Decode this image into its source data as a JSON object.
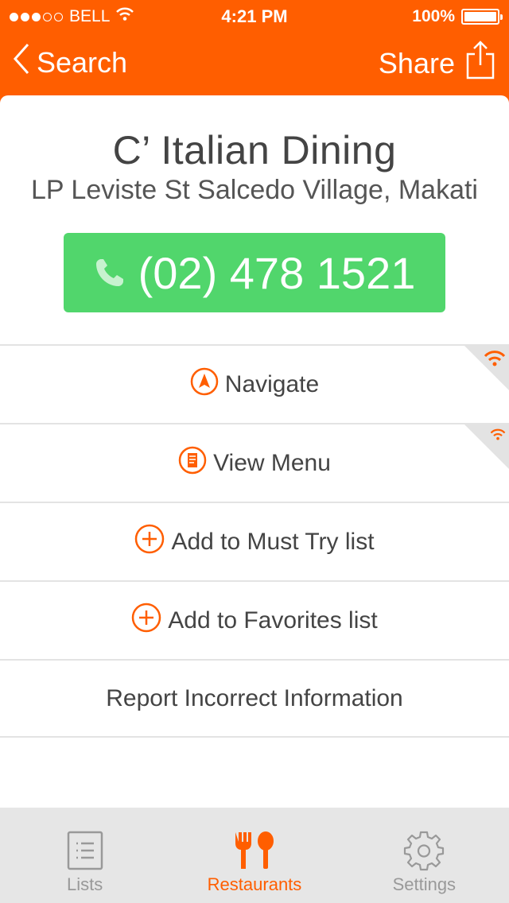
{
  "status_bar": {
    "carrier": "BELL",
    "time": "4:21 PM",
    "battery": "100%",
    "signal_bars_filled": 3,
    "signal_bars_total": 5
  },
  "nav": {
    "back_label": "Search",
    "share_label": "Share"
  },
  "restaurant": {
    "name": "C’ Italian Dining",
    "address": "LP Leviste St Salcedo Village, Makati",
    "phone": "(02) 478 1521"
  },
  "actions": {
    "navigate": "Navigate",
    "view_menu": "View Menu",
    "add_must_try": "Add to Must Try list",
    "add_favorites": "Add to Favorites list",
    "report": "Report Incorrect Information"
  },
  "tabs": [
    {
      "label": "Lists",
      "icon": "list-icon",
      "active": false
    },
    {
      "label": "Restaurants",
      "icon": "fork-spoon-icon",
      "active": true
    },
    {
      "label": "Settings",
      "icon": "gear-icon",
      "active": false
    }
  ],
  "colors": {
    "accent": "#ff5e00",
    "phone_button": "#51d66c",
    "tab_bar": "#e6e6e6"
  }
}
